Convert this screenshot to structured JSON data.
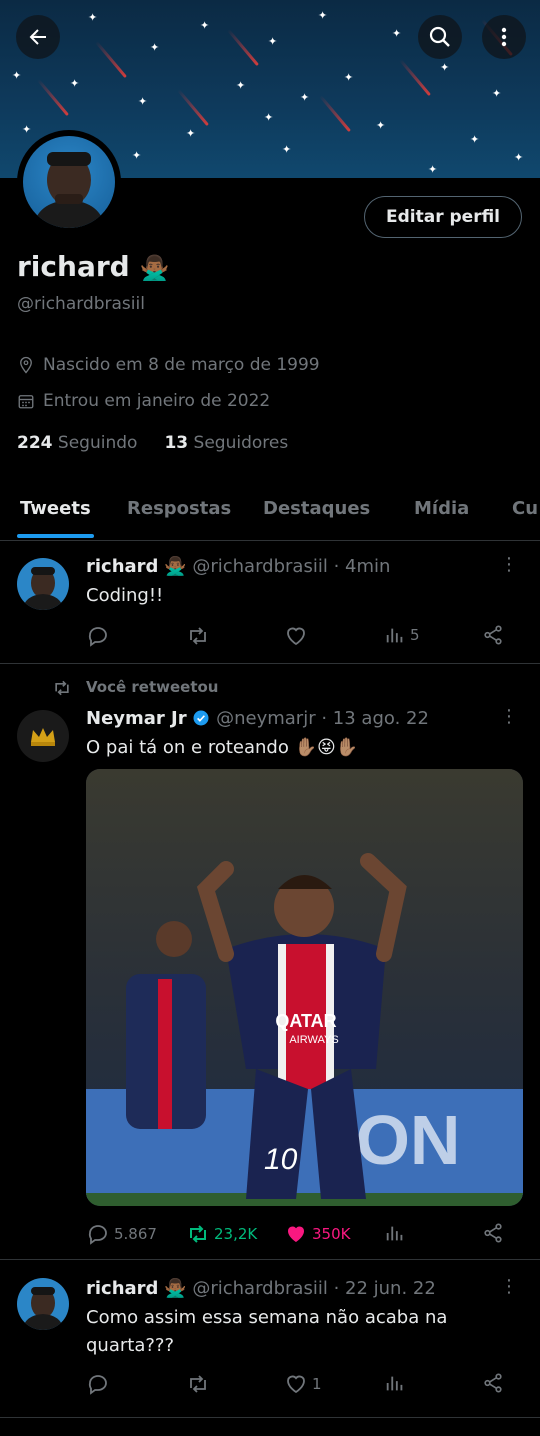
{
  "profile": {
    "name": "richard",
    "name_emoji": "🙅🏾‍♂️",
    "handle": "@richardbrasiil",
    "birth": "Nascido em 8 de março de 1999",
    "joined": "Entrou em janeiro de 2022",
    "following_count": "224",
    "following_label": "Seguindo",
    "followers_count": "13",
    "followers_label": "Seguidores",
    "edit_label": "Editar perfil"
  },
  "tabs": [
    "Tweets",
    "Respostas",
    "Destaques",
    "Mídia",
    "Cu"
  ],
  "tweets": [
    {
      "name": "richard",
      "emoji": "🙅🏾‍♂️",
      "handle": "@richardbrasiil",
      "time": "· 4min",
      "text": "Coding!!",
      "views": "5"
    },
    {
      "retweet_label": "Você retweetou",
      "name": "Neymar Jr",
      "handle": "@neymarjr",
      "time": "· 13 ago. 22",
      "text": "O pai tá on e roteando ✋🏽😝✋🏽",
      "replies": "5.867",
      "retweets": "23,2K",
      "likes": "350K",
      "photo_jersey_text": "QATAR AIRWAYS",
      "photo_number": "10"
    },
    {
      "name": "richard",
      "emoji": "🙅🏾‍♂️",
      "handle": "@richardbrasiil",
      "time": "· 22 jun. 22",
      "text": "Como assim essa semana não acaba na quarta???",
      "likes": "1"
    }
  ],
  "colors": {
    "accent": "#1d9bf0",
    "retweet": "#00ba7c",
    "like": "#f91880",
    "muted": "#71767b"
  }
}
